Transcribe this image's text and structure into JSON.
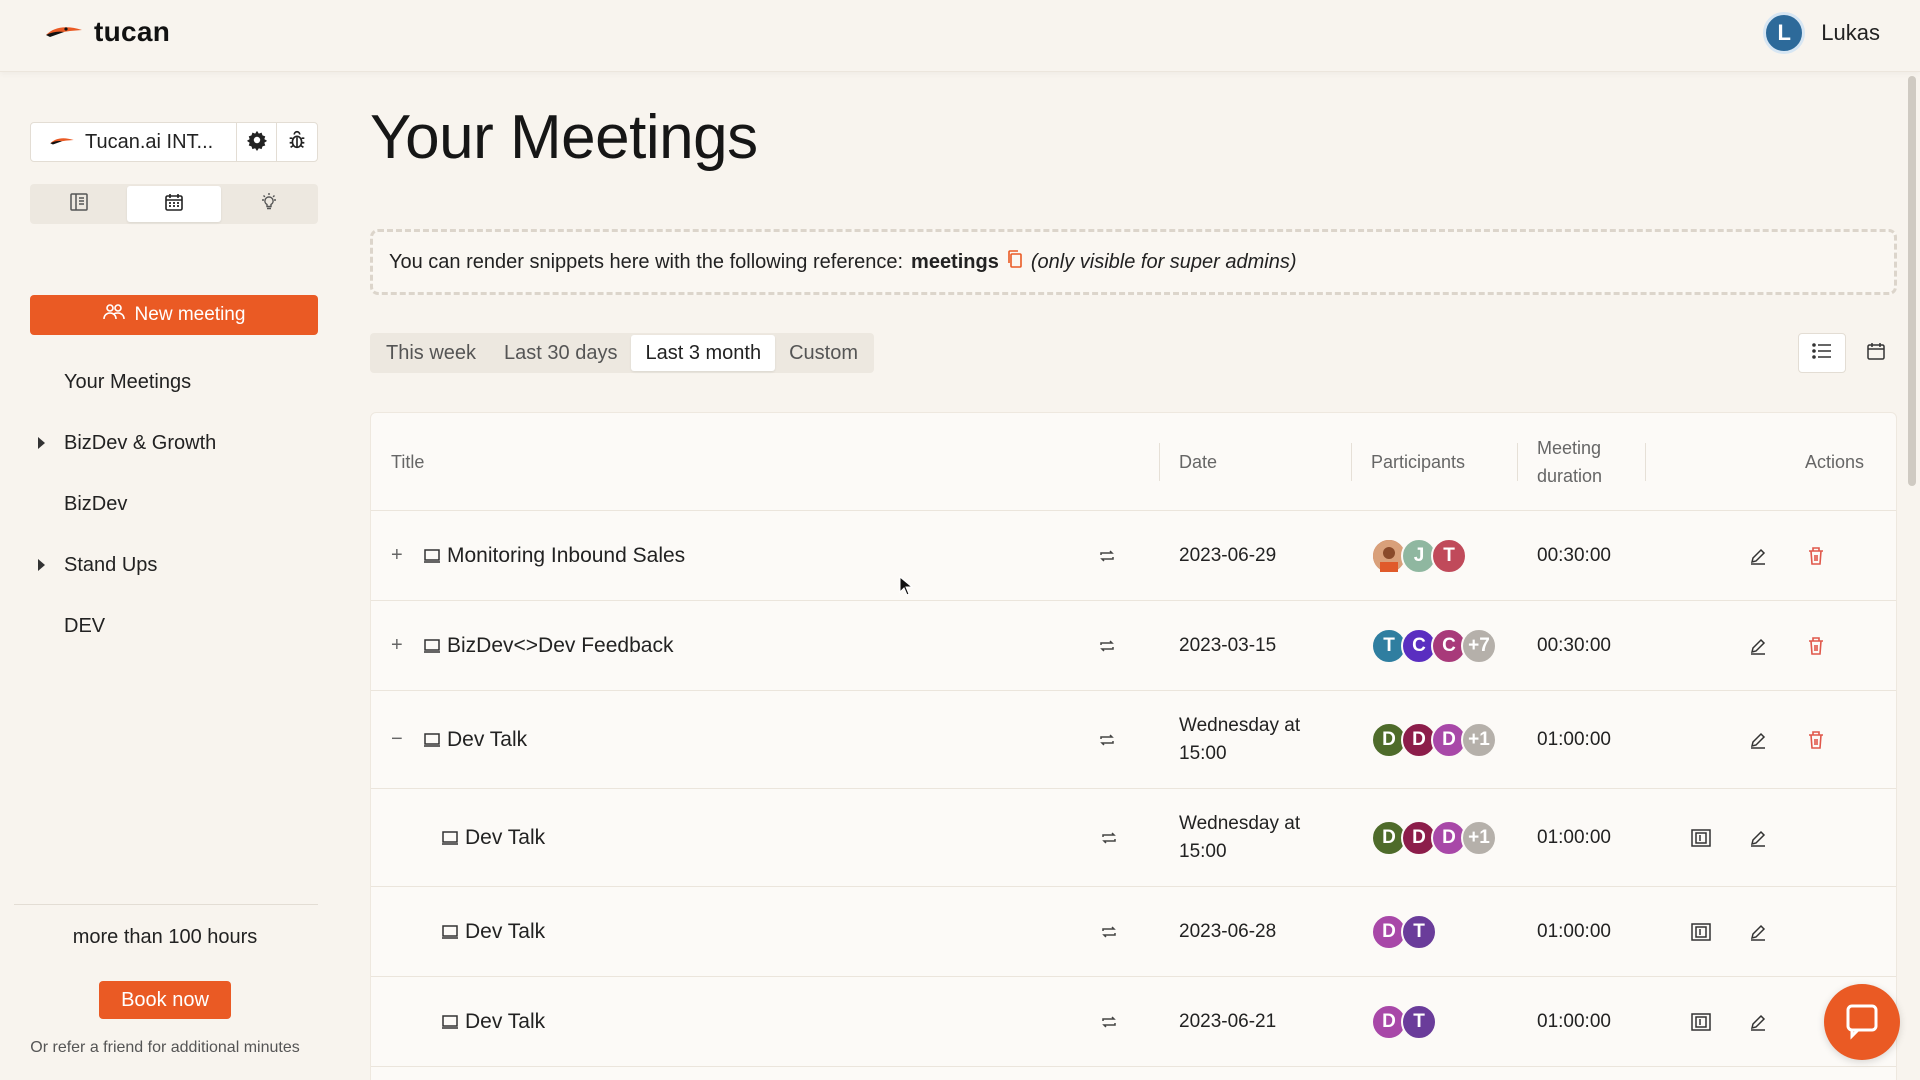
{
  "app": {
    "brand": "tucan",
    "user_initial": "L",
    "user_name": "Lukas"
  },
  "sidebar": {
    "workspace": "Tucan.ai INT...",
    "new_meeting": "New meeting",
    "items": [
      {
        "label": "Your Meetings",
        "expandable": false
      },
      {
        "label": "BizDev & Growth",
        "expandable": true
      },
      {
        "label": "BizDev",
        "expandable": false
      },
      {
        "label": "Stand Ups",
        "expandable": true
      },
      {
        "label": "DEV",
        "expandable": false
      }
    ],
    "promo": "more than 100 hours",
    "book_now": "Book now",
    "refer": "Or refer a friend for additional minutes"
  },
  "main": {
    "title": "Your Meetings",
    "snippet": {
      "prefix": "You can render snippets here with the following reference:",
      "ref": "meetings",
      "note": "(only visible for super admins)"
    },
    "filters": [
      "This week",
      "Last 30 days",
      "Last 3 month",
      "Custom"
    ],
    "active_filter": "Last 3 month",
    "columns": {
      "title": "Title",
      "date": "Date",
      "participants": "Participants",
      "duration_1": "Meeting",
      "duration_2": "duration",
      "actions": "Actions"
    },
    "rows": [
      {
        "title": "Monitoring Inbound Sales",
        "date": "2023-06-29",
        "duration": "00:30:00"
      },
      {
        "title": "BizDev<>Dev Feedback",
        "date": "2023-03-15",
        "duration": "00:30:00",
        "more": "+7"
      },
      {
        "title": "Dev Talk",
        "date_1": "Wednesday at",
        "date_2": "15:00",
        "duration": "01:00:00",
        "more": "+1"
      },
      {
        "title": "Dev Talk",
        "date_1": "Wednesday at",
        "date_2": "15:00",
        "duration": "01:00:00",
        "more": "+1"
      },
      {
        "title": "Dev Talk",
        "date": "2023-06-28",
        "duration": "01:00:00"
      },
      {
        "title": "Dev Talk",
        "date": "2023-06-21",
        "duration": "01:00:00"
      }
    ]
  },
  "colors": {
    "accent": "#ea5a24",
    "danger": "#e0574a",
    "bg": "#f8f4ee"
  }
}
